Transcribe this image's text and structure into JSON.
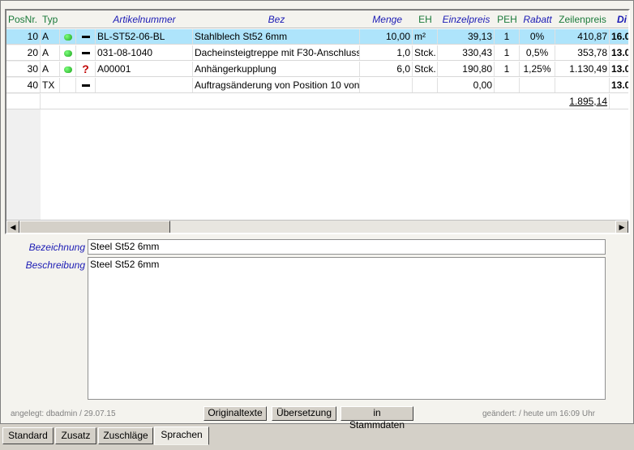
{
  "columns": [
    "PosNr.",
    "Typ",
    "",
    "",
    "Artikelnummer",
    "Bez",
    "Menge",
    "EH",
    "Einzelpreis",
    "PEH",
    "Rabatt",
    "Zeilenpreis",
    "Di"
  ],
  "rows": [
    {
      "pos": "10",
      "typ": "A",
      "dot": true,
      "mark": "dash",
      "art": "BL-ST52-06-BL",
      "bez": "Stahlblech St52 6mm",
      "menge": "10,00",
      "eh": "m²",
      "ep": "39,13",
      "peh": "1",
      "rabatt": "0%",
      "zp": "410,87",
      "di": "16.0"
    },
    {
      "pos": "20",
      "typ": "A",
      "dot": true,
      "mark": "dash",
      "art": "031-08-1040",
      "bez": "Dacheinsteigtreppe mit F30-Anschluss",
      "menge": "1,0",
      "eh": "Stck.",
      "ep": "330,43",
      "peh": "1",
      "rabatt": "0,5%",
      "zp": "353,78",
      "di": "13.0"
    },
    {
      "pos": "30",
      "typ": "A",
      "dot": true,
      "mark": "question",
      "art": "A00001",
      "bez": "Anhängerkupplung",
      "menge": "6,0",
      "eh": "Stck.",
      "ep": "190,80",
      "peh": "1",
      "rabatt": "1,25%",
      "zp": "1.130,49",
      "di": "13.0"
    },
    {
      "pos": "40",
      "typ": "TX",
      "dot": false,
      "mark": "dash",
      "art": "",
      "bez": "Auftragsänderung von Position 10 von",
      "menge": "",
      "eh": "",
      "ep": "0,00",
      "peh": "",
      "rabatt": "",
      "zp": "",
      "di": "13.0"
    }
  ],
  "total": "1.895,14",
  "form": {
    "bezeichnung_label": "Bezeichnung",
    "bezeichnung_value": "Steel St52 6mm",
    "beschreibung_label": "Beschreibung",
    "beschreibung_value": "Steel St52 6mm"
  },
  "meta": {
    "created": "angelegt: dbadmin / 29.07.15",
    "changed": "geändert:  / heute um 16:09 Uhr"
  },
  "buttons": {
    "originaltexte": "Originaltexte",
    "uebersetzung": "Übersetzung",
    "stammdaten": "in Stammdaten"
  },
  "tabs": [
    "Standard",
    "Zusatz",
    "Zuschläge",
    "Sprachen"
  ],
  "active_tab": "Sprachen"
}
